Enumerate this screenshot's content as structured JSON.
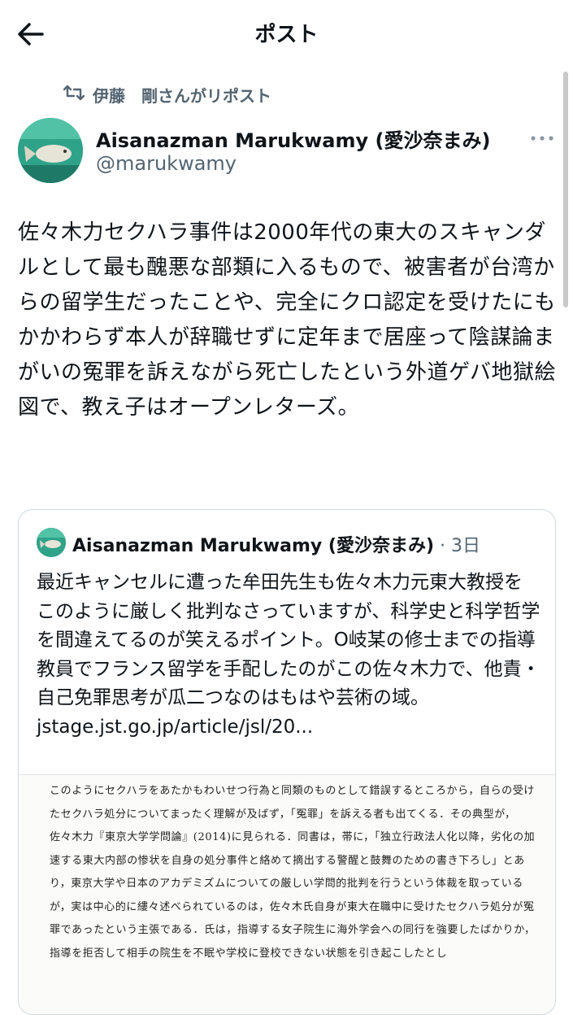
{
  "header": {
    "title": "ポスト"
  },
  "repost": {
    "label": "伊藤　剛さんがリポスト"
  },
  "post": {
    "author_name": "Aisanazman Marukwamy (愛沙奈まみ)",
    "author_handle": "@marukwamy",
    "text": "佐々木力セクハラ事件は2000年代の東大のスキャンダルとして最も醜悪な部類に入るもので、被害者が台湾からの留学生だったことや、完全にクロ認定を受けたにもかかわらず本人が辞職せずに定年まで居座って陰謀論まがいの冤罪を訴えながら死亡したという外道ゲバ地獄絵図で、教え子はオープンレターズ。"
  },
  "quoted": {
    "author_name": "Aisanazman Marukwamy (愛沙奈まみ)",
    "meta": " · 3日",
    "text": "最近キャンセルに遭った牟田先生も佐々木力元東大教授をこのように厳しく批判なさっていますが、科学史と科学哲学を間違えてるのが笑えるポイント。O岐某の修士までの指導教員でフランス留学を手配したのがこの佐々木力で、他責・自己免罪思考が瓜二つなのはもはや芸術の域。",
    "link": "jstage.jst.go.jp/article/jsl/20...",
    "image_text": "このようにセクハラをあたかもわいせつ行為と同類のものとして錯誤するところから，自らの受けたセクハラ処分についてまったく理解が及ばず，「冤罪」を訴える者も出てくる．その典型が，佐々木力『東京大学学問論』(2014)に見られる．同書は，帯に，「独立行政法人化以降，劣化の加速する東大内部の惨状を自身の処分事件と絡めて摘出する警醒と鼓舞のための書き下ろし」とあり，東京大学や日本のアカデミズムについての厳しい学問的批判を行うという体裁を取っているが，実は中心的に縷々述べられているのは，佐々木氏自身が東大在職中に受けたセクハラ処分が冤罪であったという主張である．氏は，指導する女子院生に海外学会への同行を強要したばかりか，指導を拒否して相手の院生を不眠や学校に登校できない状態を引き起こしたとし"
  },
  "colors": {
    "text": "#0f1419",
    "secondary": "#536471",
    "border": "#cfd9de",
    "avatar_bg": "#2fa38a"
  }
}
